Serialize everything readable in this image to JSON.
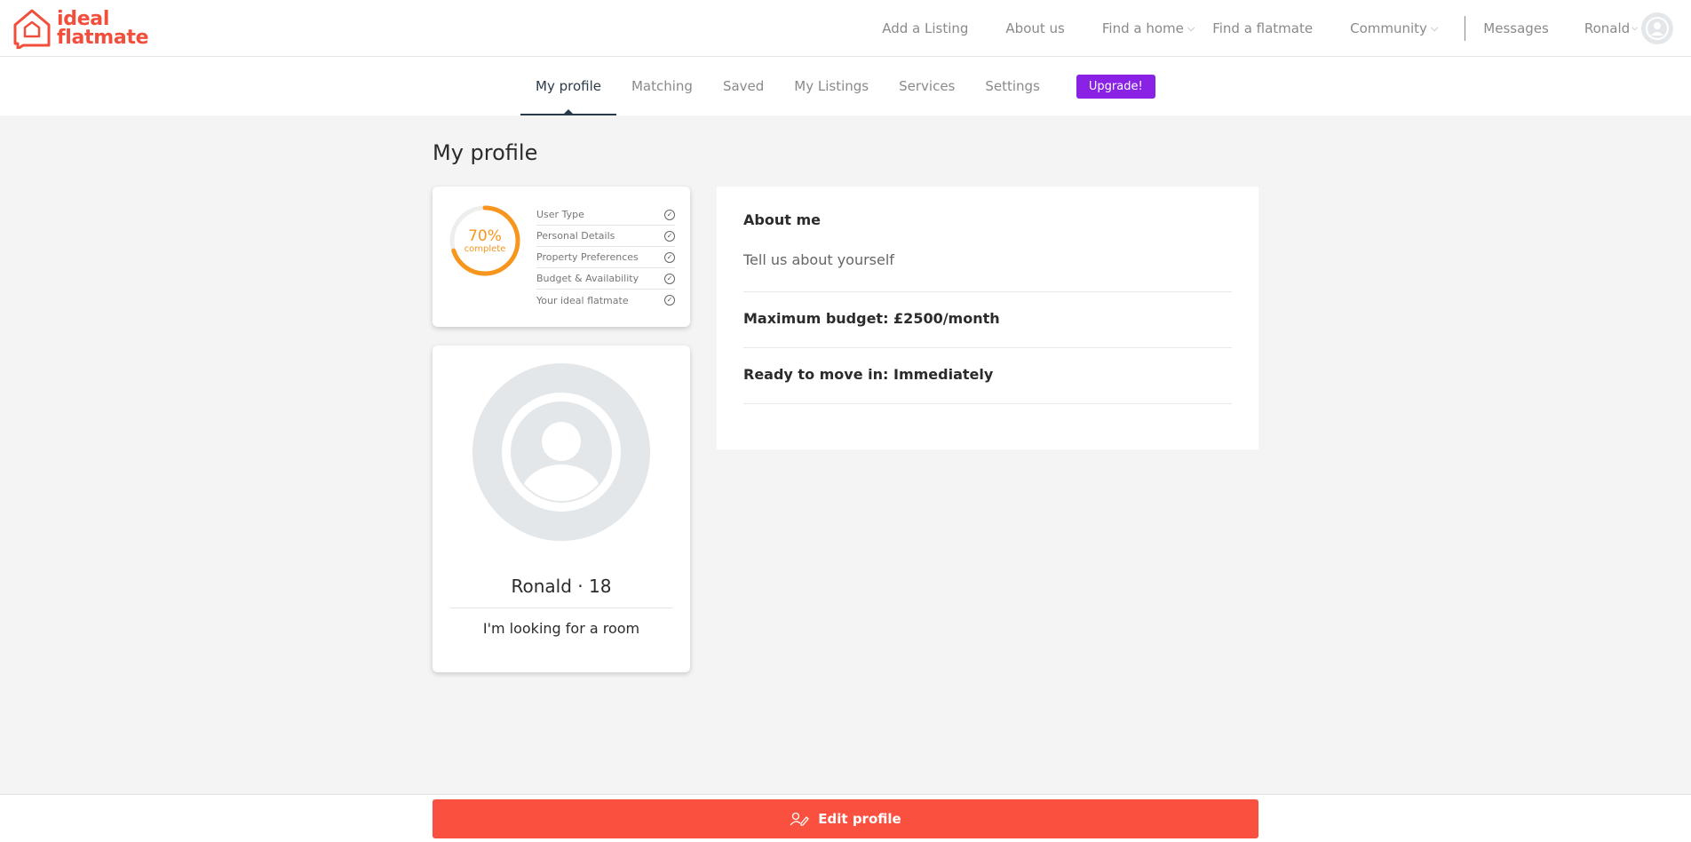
{
  "logo": {
    "line1": "ideal",
    "line2": "flatmate",
    "color": "#f24e3c"
  },
  "topnav": {
    "items": [
      {
        "label": "Add a Listing"
      },
      {
        "label": "About us"
      },
      {
        "label": "Find a home"
      },
      {
        "label": "Find a flatmate"
      },
      {
        "label": "Community"
      },
      {
        "label": "Messages"
      }
    ],
    "user_name": "Ronald"
  },
  "subnav": {
    "tabs": [
      "My profile",
      "Matching",
      "Saved",
      "My Listings",
      "Services",
      "Settings"
    ],
    "active_tab": "My profile",
    "upgrade_label": "Upgrade!",
    "upgrade_color": "#8a22e6"
  },
  "page_title": "My profile",
  "completion": {
    "percent_label": "70%",
    "percent_value": 70,
    "complete_label": "complete",
    "accent_color": "#f7951d",
    "items": [
      "User Type",
      "Personal Details",
      "Property Preferences",
      "Budget & Availability",
      "Your ideal flatmate"
    ]
  },
  "profile": {
    "name": "Ronald",
    "age": "18",
    "separator": "·",
    "looking_for": "I'm looking for a room"
  },
  "about": {
    "heading": "About me",
    "prompt": "Tell us about yourself",
    "budget": "Maximum budget: £2500/month",
    "move_in": "Ready to move in: Immediately"
  },
  "footer": {
    "edit_label": "Edit profile",
    "edit_color": "#fa5040"
  }
}
